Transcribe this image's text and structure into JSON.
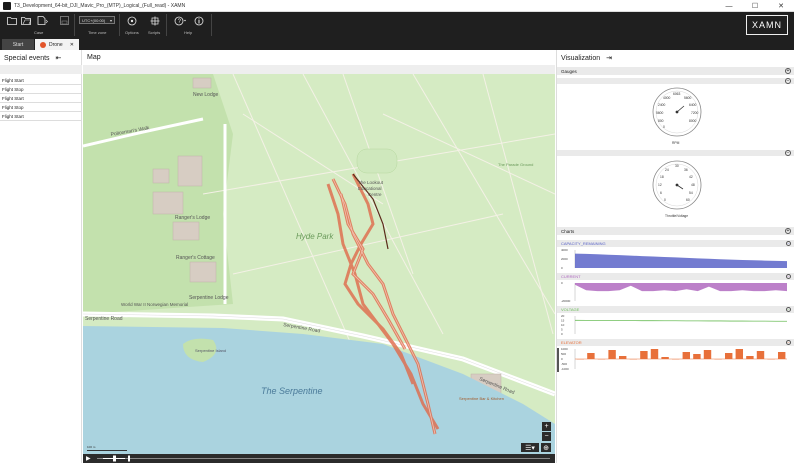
{
  "window": {
    "title": "T3_Development_64-bit_DJI_Mavic_Pro_(MTP)_Logical_(Full_read) - XAMN",
    "controls": [
      "—",
      "☐",
      "✕"
    ]
  },
  "ribbon": {
    "case_label": "Case",
    "timezone_value": "UTC+(00:00)",
    "timezone_label": "Time zone",
    "options_label": "Options",
    "scripts_label": "Scripts",
    "help_label": "Help",
    "brand": "XAMN"
  },
  "tabs": {
    "start": "Start",
    "drone": "Drone",
    "close": "✕"
  },
  "special_events": {
    "title": "Special events",
    "pin": "⇤",
    "items": [
      "Flight Start",
      "Flight Stop",
      "Flight Start",
      "Flight Stop",
      "Flight Start"
    ]
  },
  "map": {
    "title": "Map",
    "labels": {
      "new_lodge": "New\nLodge",
      "magazine_walk": "Policeman's Walk",
      "lookout": "The Lookout\nEducational\nCentre",
      "hyde_park": "Hyde Park",
      "rangers_lodge": "Ranger's\nLodge",
      "rangers_cottage": "Ranger's\nCottage",
      "ww2_memorial": "World\nWar II\nNorwegian\nMemorial",
      "serpentine_lodge": "Serpentine\nLodge",
      "serpentine_road_left": "Serpentine Road",
      "serpentine_road_mid": "Serpentine Road",
      "serpentine_road_right": "Serpentine Road",
      "the_serpentine": "The Serpentine",
      "serpentine_island": "Serpentine\nIsland",
      "the_parade_ground": "The Parade\nGround",
      "bar_kitchen": "Serpentine\nBar & Kitchen",
      "police_station": "The Old\nPolice\nStation",
      "magazine": "Magazine\nCorral"
    },
    "zoom_in": "+",
    "zoom_out": "−",
    "play": "▶",
    "scale": "100 m"
  },
  "visualization": {
    "title": "Visualization",
    "pin": "⇥",
    "gauges_label": "Gauges",
    "charts_label": "Charts",
    "toggle": "−",
    "toggle_open": "+",
    "gauge1": {
      "unit": "RPM",
      "ticks": [
        "0",
        "1600",
        "3200",
        "4800",
        "6400",
        "8000",
        "9600",
        "11200",
        "12800"
      ],
      "tick_labels_visible": [
        "3200",
        "6400",
        "6063",
        "5600",
        "4000",
        "2400",
        "800",
        "8000",
        "7200",
        "0"
      ]
    },
    "gauge2": {
      "unit": "Throttle/Voltage",
      "ticks": [
        "0",
        "6",
        "12",
        "18",
        "24",
        "30",
        "36",
        "42",
        "48",
        "54",
        "60"
      ]
    }
  },
  "colors": {
    "ribbon_bg": "#1f1f1f",
    "capacity": "#5a64c8",
    "current": "#b06ac0",
    "voltage": "#6dbe5a",
    "elevator": "#e8703a",
    "track": "#d9553a",
    "water": "#aad3df",
    "park": "#d9ecc7",
    "road": "#ffffff"
  },
  "chart_data": [
    {
      "type": "area",
      "series": [
        {
          "name": "CAPACITY_REMAINING",
          "values": [
            3200,
            3150,
            3050,
            2950,
            2850,
            2750,
            2650,
            2550,
            2450,
            2350,
            2250,
            2150,
            2050,
            1950,
            1850,
            1780,
            1720,
            1650,
            1580,
            1520
          ]
        }
      ],
      "yticks": [
        "4000",
        "2000",
        "0"
      ],
      "ylim": [
        0,
        4000
      ]
    },
    {
      "type": "area",
      "series": [
        {
          "name": "CURRENT",
          "values": [
            -2,
            -8,
            -9,
            -9,
            -8,
            -3,
            -9,
            -9,
            -8,
            -9,
            -7,
            -9,
            -4,
            -9,
            -9,
            -8,
            -9,
            -9,
            -8,
            -9
          ]
        }
      ],
      "yticks": [
        "0",
        "-20000"
      ],
      "ylim": [
        -20,
        0
      ]
    },
    {
      "type": "line",
      "series": [
        {
          "name": "VOLTAGE",
          "values": [
            15.2,
            15.1,
            15.0,
            15.0,
            14.9,
            14.9,
            14.8,
            14.8,
            14.7,
            14.7,
            14.6,
            14.6,
            14.5,
            14.5,
            14.4,
            14.4,
            14.3,
            14.3,
            14.2,
            14.2
          ]
        }
      ],
      "yticks": [
        "20",
        "15",
        "10",
        "5",
        "0"
      ],
      "ylim": [
        0,
        20
      ]
    },
    {
      "type": "bar",
      "series": [
        {
          "name": "ELEVATOR",
          "values": [
            0,
            600,
            0,
            900,
            300,
            0,
            800,
            1000,
            200,
            0,
            700,
            500,
            900,
            0,
            600,
            1000,
            300,
            800,
            0,
            700
          ]
        }
      ],
      "yticks": [
        "1000",
        "500",
        "0",
        "-500",
        "-1000"
      ],
      "ylim": [
        -1000,
        1000
      ]
    }
  ]
}
